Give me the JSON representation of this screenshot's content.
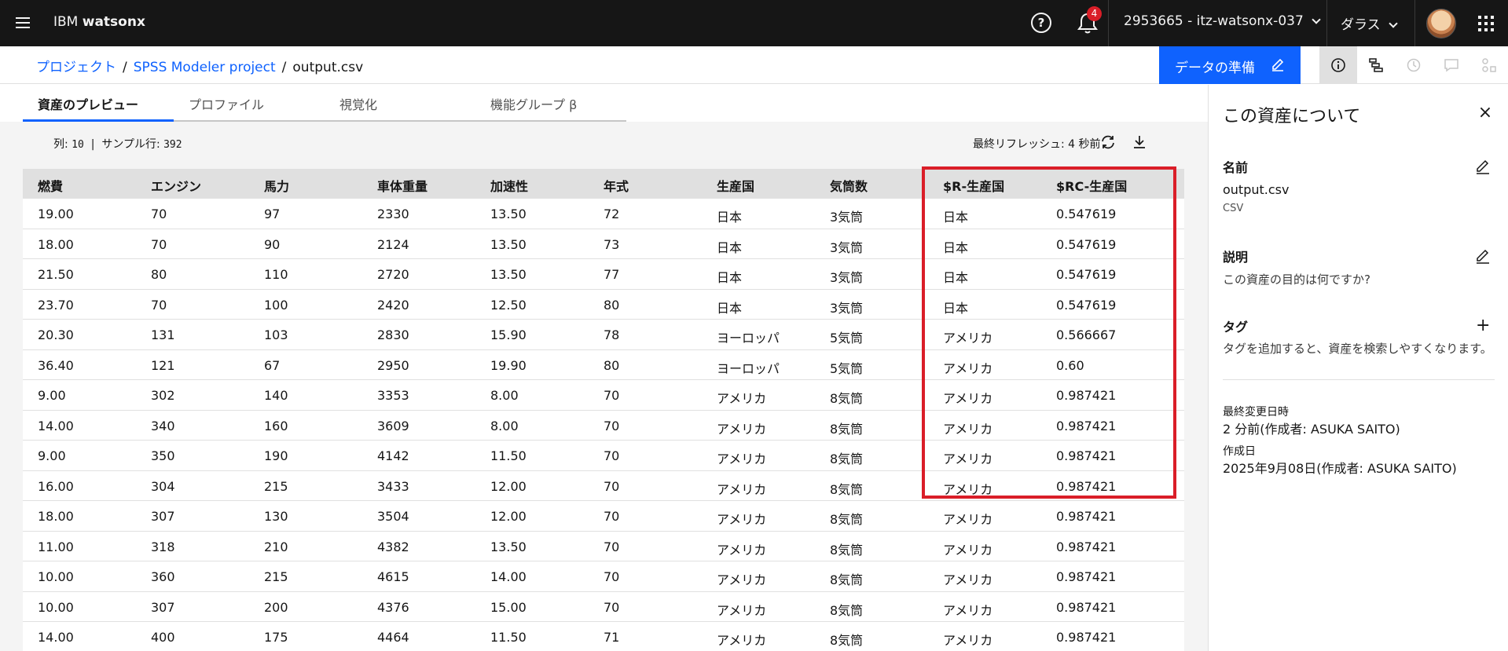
{
  "header": {
    "menu_icon": "hamburger-icon",
    "brand_prefix": "IBM",
    "brand_name": "watsonx",
    "notification_count": "4",
    "account": "2953665 - itz-watsonx-037",
    "region": "ダラス"
  },
  "breadcrumb": {
    "items": [
      "プロジェクト",
      "SPSS Modeler project",
      "output.csv"
    ]
  },
  "toolbar": {
    "prepare_label": "データの準備",
    "icons": [
      "info-icon",
      "lineage-icon",
      "history-icon",
      "comment-icon",
      "related-assets-icon"
    ]
  },
  "tabs": [
    "資産のプレビュー",
    "プロファイル",
    "視覚化",
    "機能グループ β"
  ],
  "stats": {
    "columns_label": "列:",
    "columns_value": "10",
    "separator": "|",
    "rows_label": "サンプル行:",
    "rows_value": "392",
    "refresh_text": "最終リフレッシュ: 4 秒前"
  },
  "table": {
    "headers": [
      "燃費",
      "エンジン",
      "馬力",
      "車体重量",
      "加速性",
      "年式",
      "生産国",
      "気筒数",
      "$R-生産国",
      "$RC-生産国"
    ],
    "rows": [
      [
        "19.00",
        "70",
        "97",
        "2330",
        "13.50",
        "72",
        "日本",
        "3気筒",
        "日本",
        "0.547619"
      ],
      [
        "18.00",
        "70",
        "90",
        "2124",
        "13.50",
        "73",
        "日本",
        "3気筒",
        "日本",
        "0.547619"
      ],
      [
        "21.50",
        "80",
        "110",
        "2720",
        "13.50",
        "77",
        "日本",
        "3気筒",
        "日本",
        "0.547619"
      ],
      [
        "23.70",
        "70",
        "100",
        "2420",
        "12.50",
        "80",
        "日本",
        "3気筒",
        "日本",
        "0.547619"
      ],
      [
        "20.30",
        "131",
        "103",
        "2830",
        "15.90",
        "78",
        "ヨーロッパ",
        "5気筒",
        "アメリカ",
        "0.566667"
      ],
      [
        "36.40",
        "121",
        "67",
        "2950",
        "19.90",
        "80",
        "ヨーロッパ",
        "5気筒",
        "アメリカ",
        "0.60"
      ],
      [
        "9.00",
        "302",
        "140",
        "3353",
        "8.00",
        "70",
        "アメリカ",
        "8気筒",
        "アメリカ",
        "0.987421"
      ],
      [
        "14.00",
        "340",
        "160",
        "3609",
        "8.00",
        "70",
        "アメリカ",
        "8気筒",
        "アメリカ",
        "0.987421"
      ],
      [
        "9.00",
        "350",
        "190",
        "4142",
        "11.50",
        "70",
        "アメリカ",
        "8気筒",
        "アメリカ",
        "0.987421"
      ],
      [
        "16.00",
        "304",
        "215",
        "3433",
        "12.00",
        "70",
        "アメリカ",
        "8気筒",
        "アメリカ",
        "0.987421"
      ],
      [
        "18.00",
        "307",
        "130",
        "3504",
        "12.00",
        "70",
        "アメリカ",
        "8気筒",
        "アメリカ",
        "0.987421"
      ],
      [
        "11.00",
        "318",
        "210",
        "4382",
        "13.50",
        "70",
        "アメリカ",
        "8気筒",
        "アメリカ",
        "0.987421"
      ],
      [
        "10.00",
        "360",
        "215",
        "4615",
        "14.00",
        "70",
        "アメリカ",
        "8気筒",
        "アメリカ",
        "0.987421"
      ],
      [
        "10.00",
        "307",
        "200",
        "4376",
        "15.00",
        "70",
        "アメリカ",
        "8気筒",
        "アメリカ",
        "0.987421"
      ],
      [
        "14.00",
        "400",
        "175",
        "4464",
        "11.50",
        "71",
        "アメリカ",
        "8気筒",
        "アメリカ",
        "0.987421"
      ]
    ]
  },
  "panel": {
    "title": "この資産について",
    "name_label": "名前",
    "name_value": "output.csv",
    "name_type": "CSV",
    "description_label": "説明",
    "description_placeholder": "この資産の目的は何ですか?",
    "tags_label": "タグ",
    "tags_hint": "タグを追加すると、資産を検索しやすくなります。",
    "modified_label": "最終変更日時",
    "modified_value": "2 分前(作成者: ASUKA SAITO)",
    "created_label": "作成日",
    "created_value": "2025年9月08日(作成者: ASUKA SAITO)"
  },
  "colors": {
    "accent": "#0f62fe",
    "highlight_border": "#da1e28",
    "header_bg": "#161616"
  }
}
